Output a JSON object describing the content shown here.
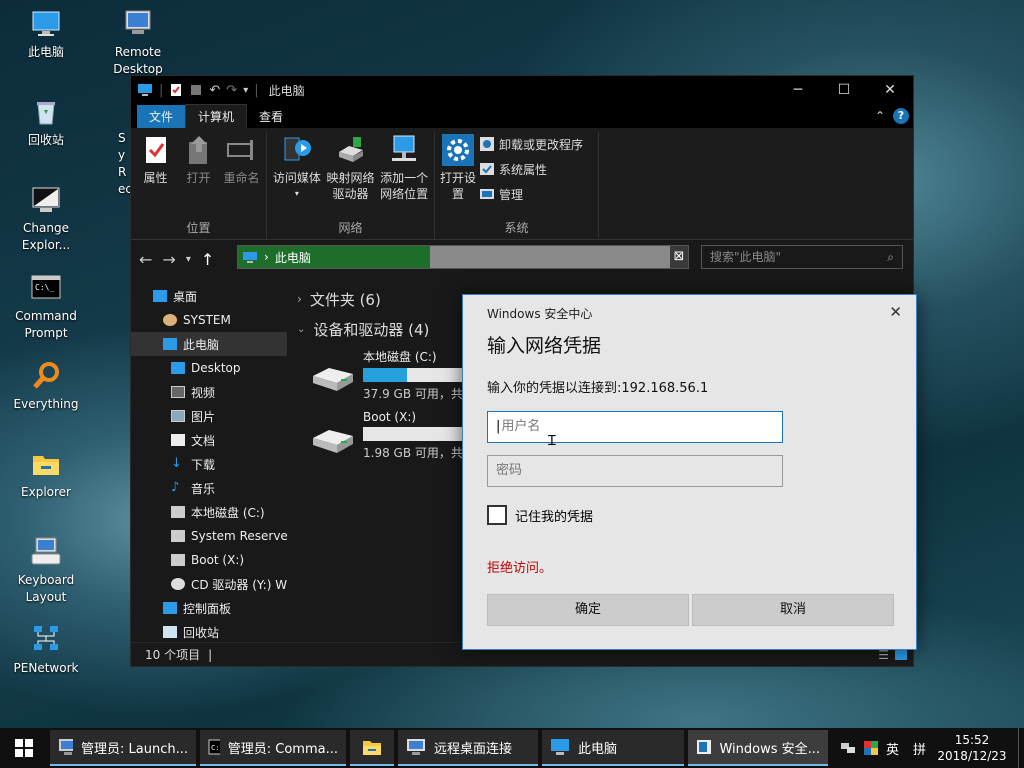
{
  "desktop": {
    "icons": [
      {
        "label": "此电脑",
        "icon": "this-pc-icon"
      },
      {
        "label": "Remote Desktop",
        "icon": "remote-desktop-icon"
      },
      {
        "label": "回收站",
        "icon": "recycle-bin-icon"
      },
      {
        "label": "Change Explor...",
        "icon": "change-explorer-icon"
      },
      {
        "label": "Command Prompt",
        "icon": "command-prompt-icon"
      },
      {
        "label": "Everything",
        "icon": "everything-search-icon"
      },
      {
        "label": "Explorer",
        "icon": "explorer-folder-icon"
      },
      {
        "label": "Keyboard Layout",
        "icon": "keyboard-icon"
      },
      {
        "label": "PENetwork",
        "icon": "network-icon"
      },
      {
        "label": "Sy Rec",
        "icon": "partial-icon"
      }
    ]
  },
  "explorer": {
    "title": "此电脑",
    "tabs": {
      "file": "文件",
      "computer": "计算机",
      "view": "查看"
    },
    "ribbon": {
      "location_group": "位置",
      "network_group": "网络",
      "system_group": "系统",
      "properties": "属性",
      "open": "打开",
      "rename": "重命名",
      "access_media": "访问媒体",
      "map_drive": "映射网络驱动器",
      "add_location": "添加一个网络位置",
      "open_settings": "打开设置",
      "uninstall": "卸载或更改程序",
      "sys_props": "系统属性",
      "manage": "管理"
    },
    "address": "此电脑",
    "search_placeholder": "搜索\"此电脑\"",
    "tree": [
      "桌面",
      "SYSTEM",
      "此电脑",
      "Desktop",
      "视频",
      "图片",
      "文档",
      "下载",
      "音乐",
      "本地磁盘 (C:)",
      "System Reserved",
      "Boot (X:)",
      "CD 驱动器 (Y:) W",
      "控制面板",
      "回收站"
    ],
    "folders_section": "文件夹 (6)",
    "devices_section": "设备和驱动器 (4)",
    "drives": [
      {
        "name": "本地磁盘 (C:)",
        "free": "37.9 GB 可用，共",
        "used_fraction": 0.4
      },
      {
        "name": "Boot (X:)",
        "free": "1.98 GB 可用，共",
        "used_fraction": 0.0
      }
    ],
    "status": "10 个项目"
  },
  "dialog": {
    "window_title": "Windows 安全中心",
    "heading": "输入网络凭据",
    "message": "输入你的凭据以连接到:192.168.56.1",
    "username_placeholder": "用户名",
    "password_placeholder": "密码",
    "remember": "记住我的凭据",
    "error": "拒绝访问。",
    "ok": "确定",
    "cancel": "取消",
    "error_color": "#c00000"
  },
  "taskbar": {
    "items": [
      {
        "label": "管理员: Launch...",
        "icon": "launcher-icon"
      },
      {
        "label": "管理员: Comma...",
        "icon": "cmd-icon"
      },
      {
        "label": "",
        "icon": "folder-icon"
      },
      {
        "label": "远程桌面连接",
        "icon": "remote-desktop-icon"
      },
      {
        "label": "此电脑",
        "icon": "this-pc-icon"
      },
      {
        "label": "Windows 安全...",
        "icon": "security-icon"
      }
    ],
    "ime": "英",
    "ime2": "拼",
    "time": "15:52",
    "date": "2018/12/23"
  },
  "colors": {
    "accent": "#1a74b8",
    "address_fill": "#1f6d2a",
    "drive_bar": "#26a0da"
  }
}
